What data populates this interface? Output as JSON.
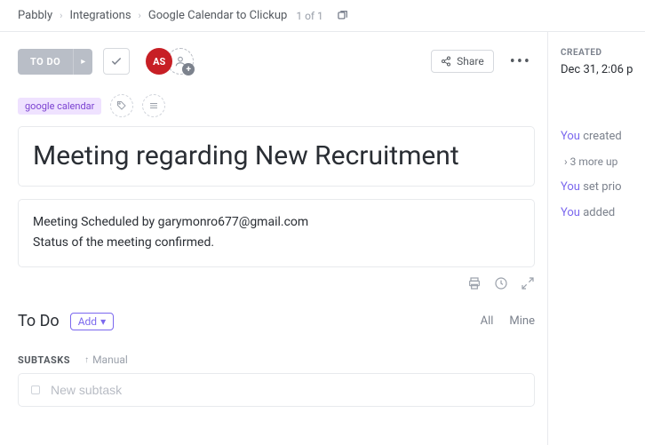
{
  "breadcrumb": {
    "items": [
      "Pabbly",
      "Integrations",
      "Google Calendar to Clickup"
    ],
    "count": "1 of 1"
  },
  "toolbar": {
    "status": "TO DO",
    "share": "Share"
  },
  "assignee": {
    "initials": "AS"
  },
  "tags": {
    "primary": "google calendar"
  },
  "title": "Meeting regarding New Recruitment",
  "description": {
    "line1": "Meeting Scheduled by garymonro677@gmail.com",
    "line2": "Status of the meeting confirmed."
  },
  "todo": {
    "heading": "To Do",
    "add": "Add",
    "filter_all": "All",
    "filter_mine": "Mine",
    "subtasks_label": "SUBTASKS",
    "manual": "Manual",
    "new_placeholder": "New subtask"
  },
  "sidebar": {
    "created_label": "CREATED",
    "created_value": "Dec 31, 2:06 p",
    "you": "You",
    "a1": " created",
    "more": "3 more up",
    "a2": " set prio",
    "a3": " added "
  }
}
